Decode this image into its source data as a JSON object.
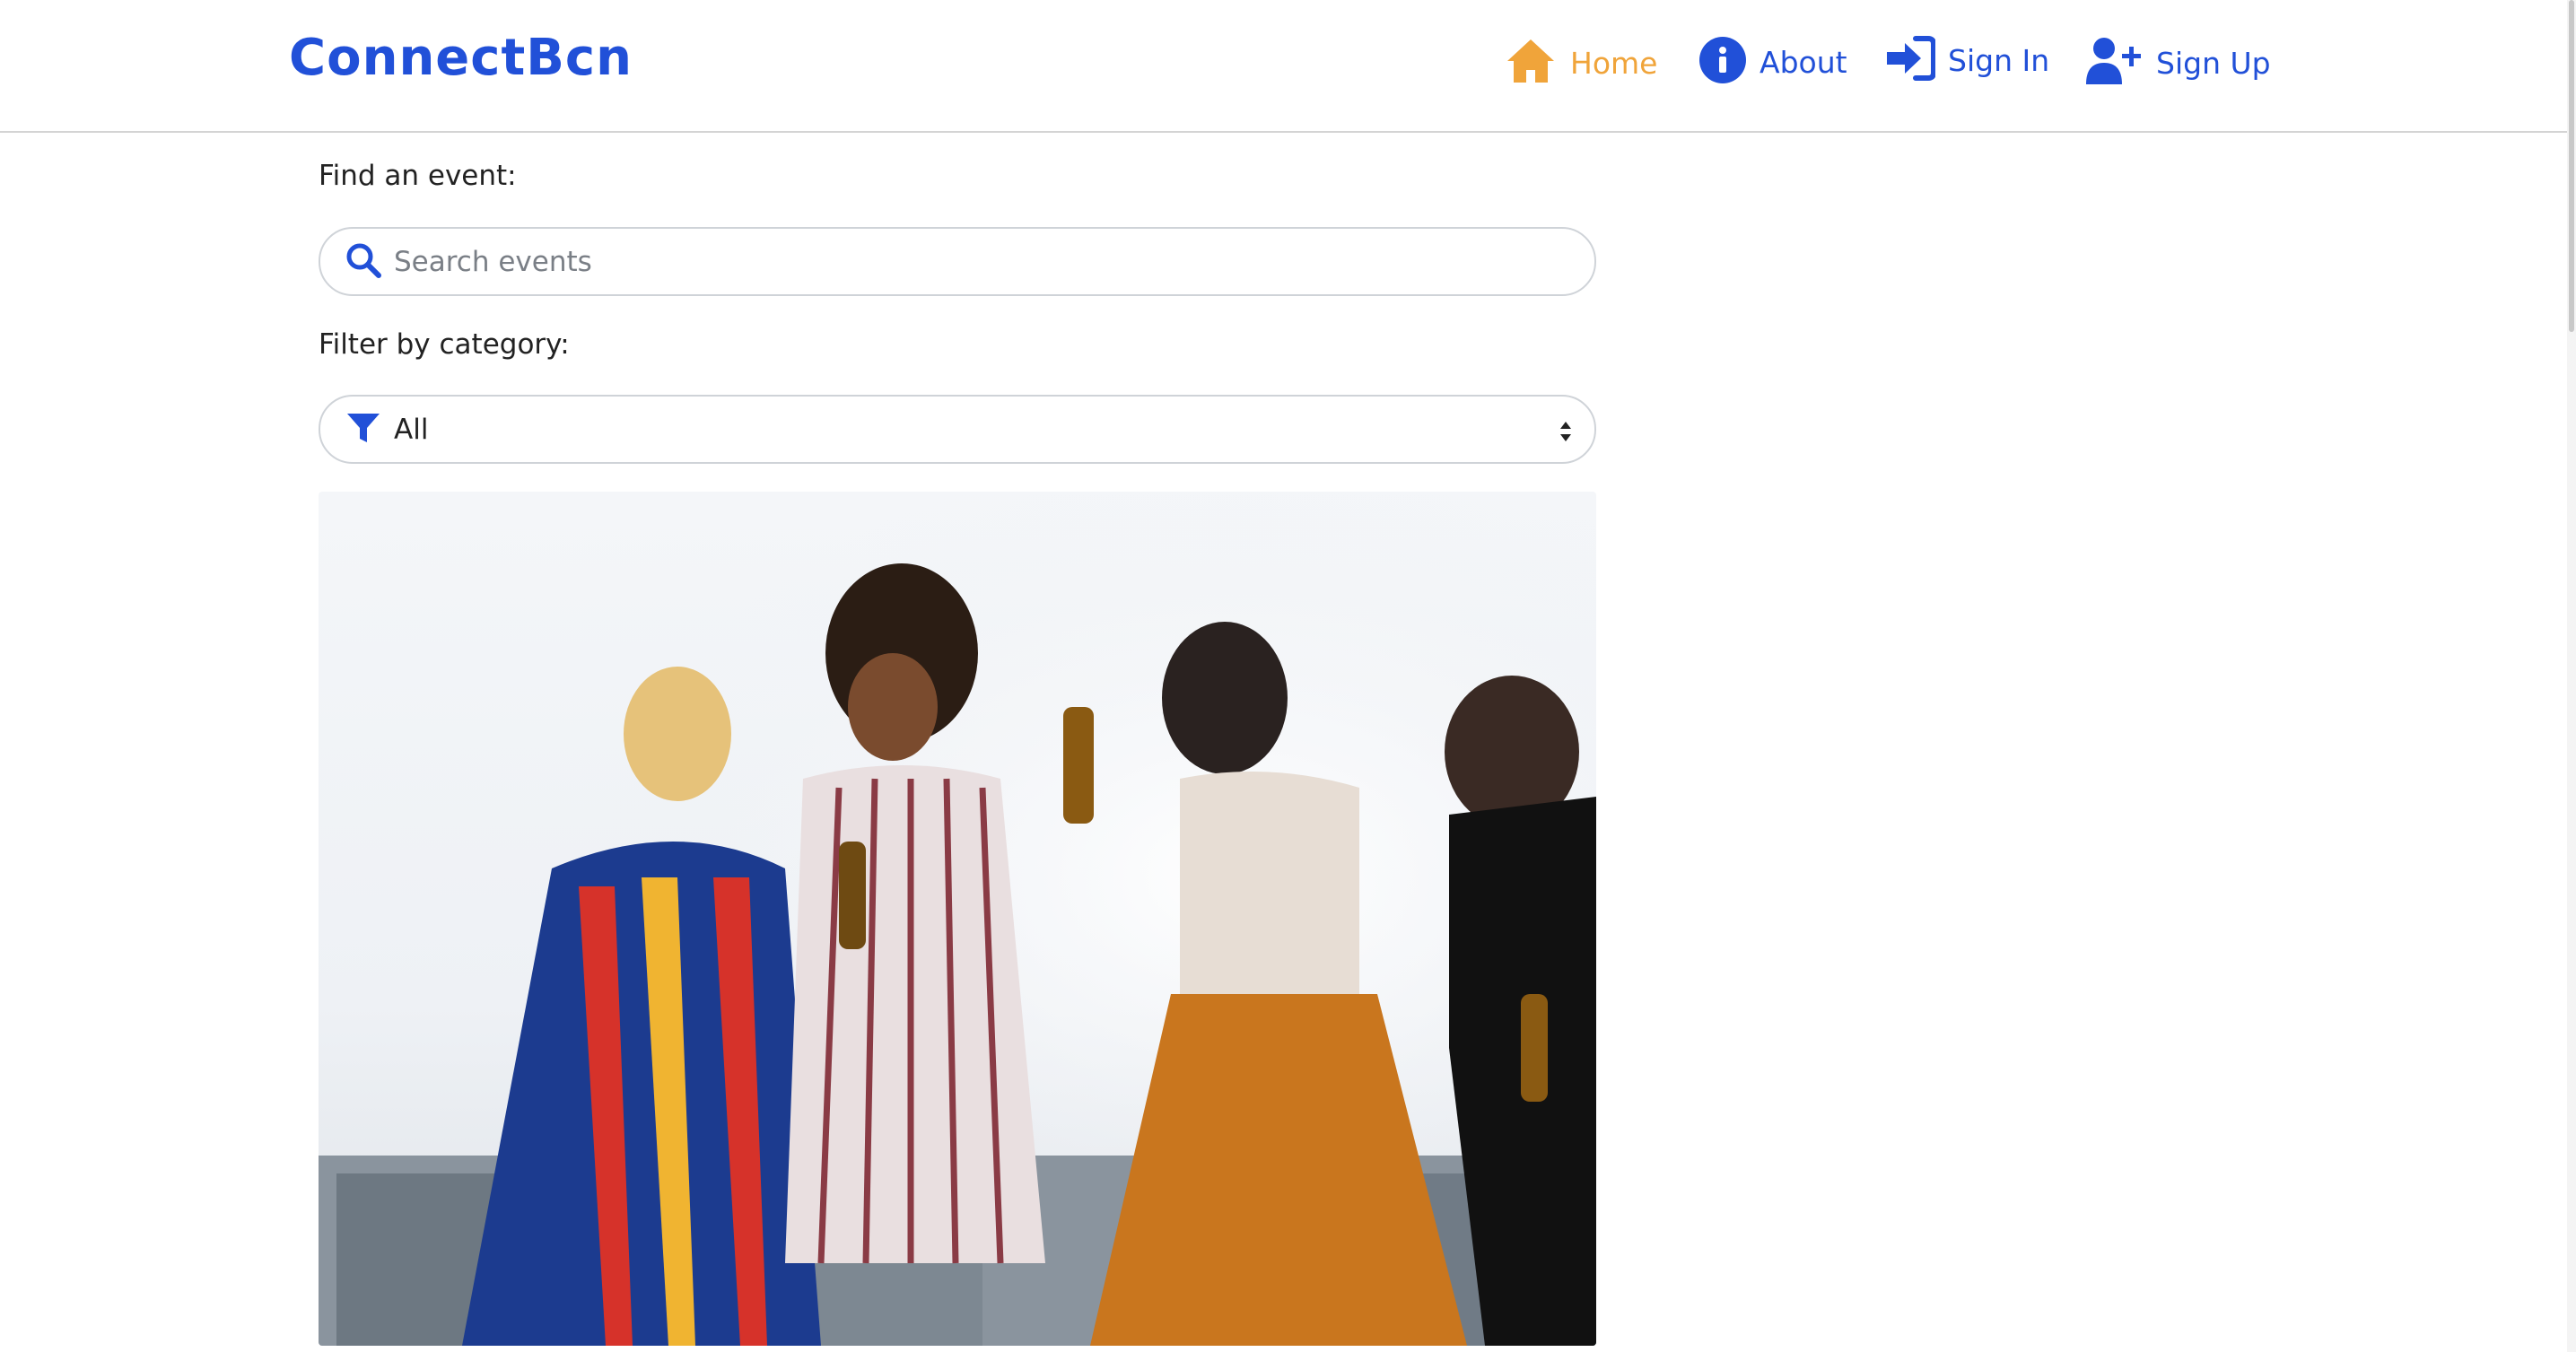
{
  "header": {
    "brand": "ConnectBcn",
    "nav": [
      {
        "label": "Home",
        "icon": "home-icon",
        "active": true
      },
      {
        "label": "About",
        "icon": "info-icon"
      },
      {
        "label": "Sign In",
        "icon": "sign-in-icon"
      },
      {
        "label": "Sign Up",
        "icon": "user-plus-icon"
      }
    ]
  },
  "search": {
    "label": "Find an event:",
    "placeholder": "Search events",
    "value": ""
  },
  "filter": {
    "label": "Filter by category:",
    "selected": "All"
  },
  "colors": {
    "brand": "#2150d8",
    "active_nav": "#f0a43a",
    "nav_link": "#2150d8"
  }
}
